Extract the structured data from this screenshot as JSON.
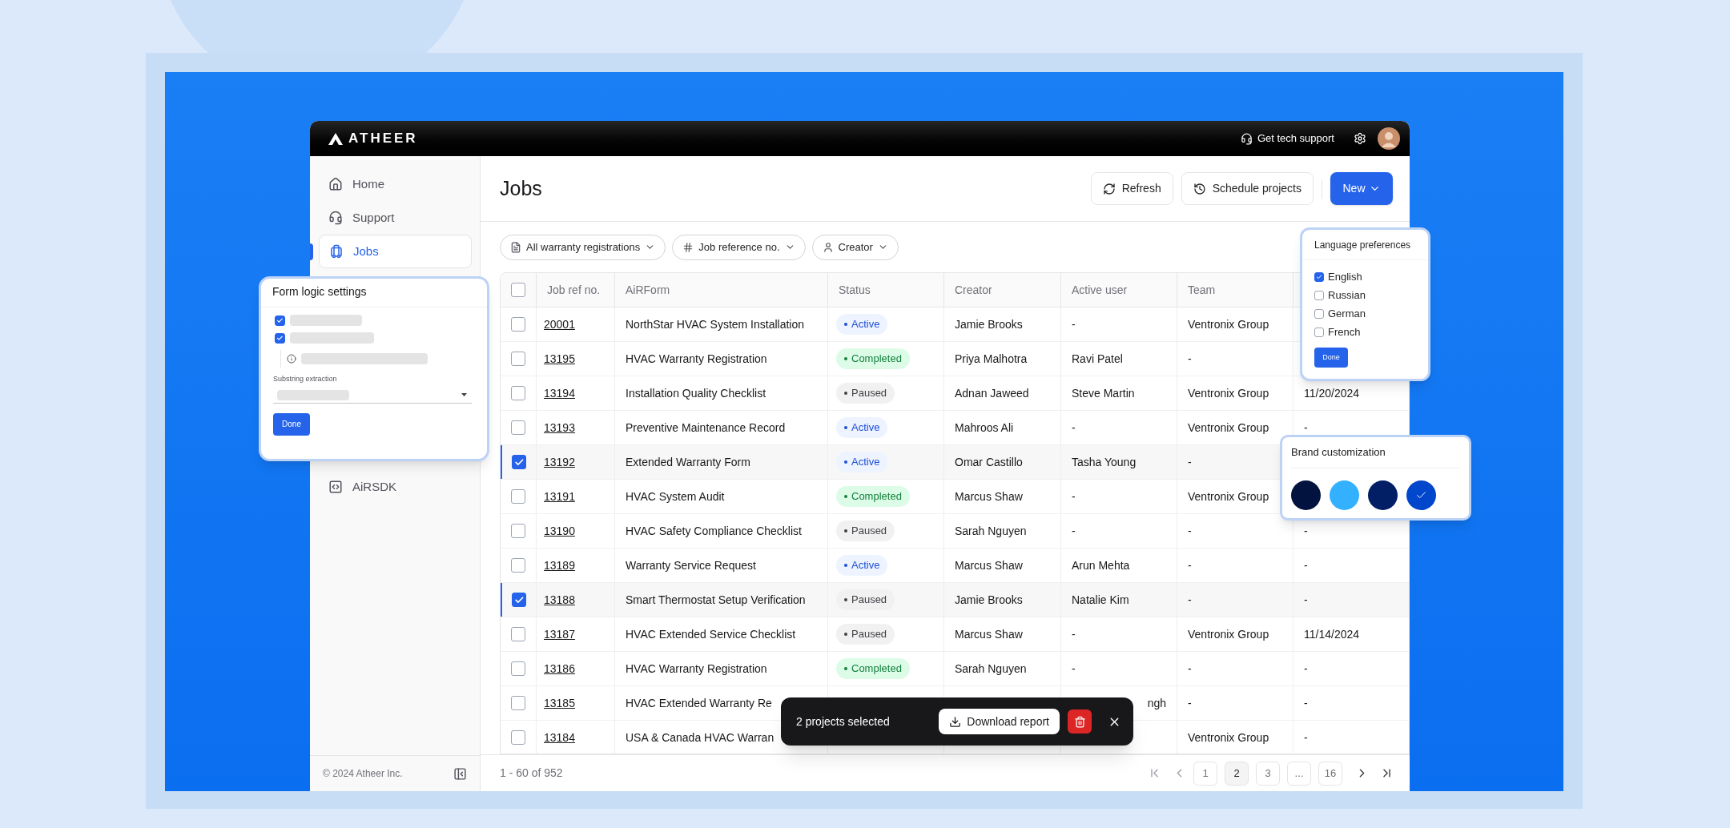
{
  "topbar": {
    "logo": "ATHEER",
    "support": "Get tech support"
  },
  "sidebar": {
    "sections": [
      {
        "items": [
          {
            "label": "Home",
            "kind": "home",
            "selected": false
          },
          {
            "label": "Support",
            "kind": "support",
            "selected": false
          },
          {
            "label": "Jobs",
            "kind": "jobs",
            "selected": true
          }
        ]
      },
      {
        "items": [
          {
            "label": "AiRSDK",
            "kind": "sdk",
            "selected": false
          }
        ]
      }
    ],
    "footer": "© 2024 Atheer Inc."
  },
  "page": {
    "title": "Jobs",
    "actions": [
      {
        "label": "Refresh",
        "kind": "refresh"
      },
      {
        "label": "Schedule projects",
        "kind": "schedule"
      },
      {
        "label": "New",
        "kind": "primary"
      }
    ],
    "filters": [
      {
        "label": "All warranty registrations",
        "kind": "doc"
      },
      {
        "label": "Job reference no.",
        "kind": "hash"
      },
      {
        "label": "Creator",
        "kind": "user"
      }
    ]
  },
  "table": {
    "all_selected": false,
    "columns": [
      "Job ref no.",
      "AiRForm",
      "Status",
      "Creator",
      "Active user",
      "Team"
    ],
    "rows": [
      {
        "selected": false,
        "ref": "20001",
        "form": "NorthStar HVAC System Installation",
        "status": {
          "label": "Active",
          "kind": "active"
        },
        "creator": "Jamie Brooks",
        "active_user": "-",
        "team": "Ventronix Group"
      },
      {
        "selected": false,
        "ref": "13195",
        "form": "HVAC Warranty Registration",
        "status": {
          "label": "Completed",
          "kind": "completed"
        },
        "creator": "Priya Malhotra",
        "active_user": "Ravi Patel",
        "team": "-"
      },
      {
        "selected": false,
        "ref": "13194",
        "form": "Installation Quality Checklist",
        "status": {
          "label": "Paused",
          "kind": "paused"
        },
        "creator": "Adnan Jaweed",
        "active_user": "Steve Martin",
        "team": "Ventronix Group",
        "date": "11/20/2024"
      },
      {
        "selected": false,
        "ref": "13193",
        "form": "Preventive Maintenance Record",
        "status": {
          "label": "Active",
          "kind": "active"
        },
        "creator": "Mahroos Ali",
        "active_user": "-",
        "team": "Ventronix Group",
        "date": "-"
      },
      {
        "selected": true,
        "ref": "13192",
        "form": "Extended Warranty Form",
        "status": {
          "label": "Active",
          "kind": "active"
        },
        "creator": "Omar Castillo",
        "active_user": "Tasha Young",
        "team": "-"
      },
      {
        "selected": false,
        "ref": "13191",
        "form": "HVAC System Audit",
        "status": {
          "label": "Completed",
          "kind": "completed"
        },
        "creator": "Marcus Shaw",
        "active_user": "-",
        "team": "Ventronix Group"
      },
      {
        "selected": false,
        "ref": "13190",
        "form": "HVAC Safety Compliance Checklist",
        "status": {
          "label": "Paused",
          "kind": "paused"
        },
        "creator": "Sarah Nguyen",
        "active_user": "-",
        "team": "-",
        "date": "-"
      },
      {
        "selected": false,
        "ref": "13189",
        "form": "Warranty Service Request",
        "status": {
          "label": "Active",
          "kind": "active"
        },
        "creator": "Marcus Shaw",
        "active_user": "Arun Mehta",
        "team": "-",
        "date": "-"
      },
      {
        "selected": true,
        "ref": "13188",
        "form": "Smart Thermostat Setup Verification",
        "status": {
          "label": "Paused",
          "kind": "paused"
        },
        "creator": "Jamie Brooks",
        "active_user": "Natalie Kim",
        "team": "-",
        "date": "-"
      },
      {
        "selected": false,
        "ref": "13187",
        "form": "HVAC Extended Service Checklist",
        "status": {
          "label": "Paused",
          "kind": "paused"
        },
        "creator": "Marcus Shaw",
        "active_user": "-",
        "team": "Ventronix Group",
        "date": "11/14/2024"
      },
      {
        "selected": false,
        "ref": "13186",
        "form": "HVAC Warranty Registration",
        "status": {
          "label": "Completed",
          "kind": "completed"
        },
        "creator": "Sarah Nguyen",
        "active_user": "-",
        "team": "-",
        "date": "-"
      },
      {
        "selected": false,
        "ref": "13185",
        "form": "HVAC Extended Warranty Re",
        "active_user": {
          "text": "ngh",
          "kind": "tail"
        },
        "team": "-",
        "date": "-"
      },
      {
        "selected": false,
        "ref": "13184",
        "form": "USA & Canada HVAC Warran",
        "team": "Ventronix Group",
        "date": "-"
      }
    ]
  },
  "footer": {
    "range": "1 - 60 of 952",
    "pages": [
      {
        "label": "1",
        "selected": false
      },
      {
        "label": "2",
        "selected": true
      },
      {
        "label": "3",
        "selected": false
      },
      {
        "label": "...",
        "selected": false
      },
      {
        "label": "16",
        "selected": false
      }
    ]
  },
  "toast": {
    "text": "2 projects selected",
    "button": "Download report"
  },
  "form_logic": {
    "title": "Form logic settings",
    "options": [
      {
        "checked": true
      },
      {
        "checked": true
      }
    ],
    "field_label": "Substring extraction",
    "button": "Done"
  },
  "language": {
    "title": "Language preferences",
    "options": [
      {
        "label": "English",
        "checked": true
      },
      {
        "label": "Russian",
        "checked": false
      },
      {
        "label": "German",
        "checked": false
      },
      {
        "label": "French",
        "checked": false
      }
    ],
    "button": "Done"
  },
  "brand": {
    "title": "Brand customization",
    "swatches": [
      {
        "color": "#02133f",
        "selected": false
      },
      {
        "color": "#33b1ff",
        "selected": false
      },
      {
        "color": "#021f66",
        "selected": false
      },
      {
        "color": "#0047cc",
        "selected": true
      }
    ]
  }
}
